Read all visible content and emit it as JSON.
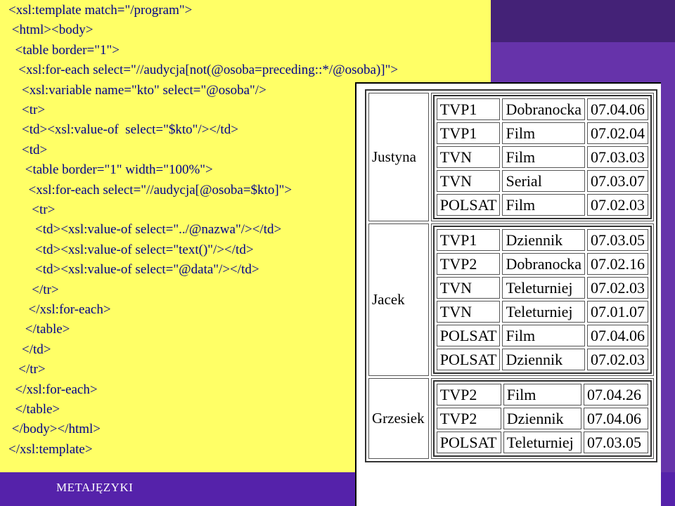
{
  "footer": {
    "label": "METAJĘZYKI"
  },
  "code_lines": [
    "<xsl:template match=\"/program\">",
    " <html><body>",
    "  <table border=\"1\">",
    "   <xsl:for-each select=\"//audycja[not(@osoba=preceding::*/@osoba)]\">",
    "    <xsl:variable name=\"kto\" select=\"@osoba\"/>",
    "    <tr>",
    "    <td><xsl:value-of  select=\"$kto\"/></td>",
    "    <td>",
    "     <table border=\"1\" width=\"100%\">",
    "      <xsl:for-each select=\"//audycja[@osoba=$kto]\">",
    "       <tr>",
    "        <td><xsl:value-of select=\"../@nazwa\"/></td>",
    "        <td><xsl:value-of select=\"text()\"/></td>",
    "        <td><xsl:value-of select=\"@data\"/></td>",
    "       </tr>",
    "      </xsl:for-each>",
    "     </table>",
    "    </td>",
    "   </tr>",
    "  </xsl:for-each>",
    "  </table>",
    " </body></html>",
    "</xsl:template>"
  ],
  "output_table": [
    {
      "name": "Justyna",
      "rows": [
        [
          "TVP1",
          "Dobranocka",
          "07.04.06"
        ],
        [
          "TVP1",
          "Film",
          "07.02.04"
        ],
        [
          "TVN",
          "Film",
          "07.03.03"
        ],
        [
          "TVN",
          "Serial",
          "07.03.07"
        ],
        [
          "POLSAT",
          "Film",
          "07.02.03"
        ]
      ]
    },
    {
      "name": "Jacek",
      "rows": [
        [
          "TVP1",
          "Dziennik",
          "07.03.05"
        ],
        [
          "TVP2",
          "Dobranocka",
          "07.02.16"
        ],
        [
          "TVN",
          "Teleturniej",
          "07.02.03"
        ],
        [
          "TVN",
          "Teleturniej",
          "07.01.07"
        ],
        [
          "POLSAT",
          "Film",
          "07.04.06"
        ],
        [
          "POLSAT",
          "Dziennik",
          "07.02.03"
        ]
      ]
    },
    {
      "name": "Grzesiek",
      "rows": [
        [
          "TVP2",
          "Film",
          "07.04.26"
        ],
        [
          "TVP2",
          "Dziennik",
          "07.04.06"
        ],
        [
          "POLSAT",
          "Teleturniej",
          "07.03.05"
        ]
      ]
    }
  ]
}
